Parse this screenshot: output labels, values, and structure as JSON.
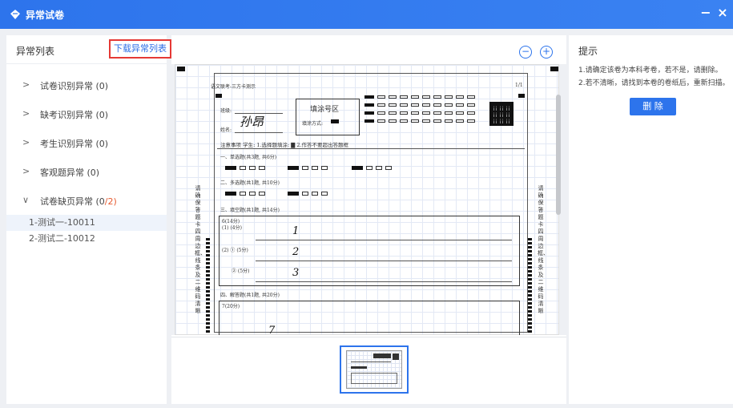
{
  "window": {
    "title": "异常试卷",
    "minimize": "−",
    "close": "×"
  },
  "left": {
    "title": "异常列表",
    "download_btn": "下载异常列表",
    "categories": [
      {
        "label": "试卷识别异常",
        "count": "(0)"
      },
      {
        "label": "缺考识别异常",
        "count": "(0)"
      },
      {
        "label": "考生识别异常",
        "count": "(0)"
      },
      {
        "label": "客观题异常",
        "count": "(0)"
      },
      {
        "label": "试卷缺页异常",
        "count_a": "(0",
        "count_b": "/2)"
      }
    ],
    "items": [
      "1-测试一-10011",
      "2-测试二-10012"
    ]
  },
  "sheet": {
    "header": "语文联考-三方卡测示",
    "page_num": "1/1",
    "class_label": "班级:",
    "name_label": "姓名:",
    "fill_area": "填涂号区",
    "fill_method": "填涂方式:",
    "notice": "注意事项  学生: 1.选择题填涂: ▇ 2.作答不要超出答题框",
    "sec1": "一、单选题(共3题, 共6分)",
    "sec2": "二、多选题(共1题, 共10分)",
    "sec3": "三、填空题(共1题, 共14分)",
    "sec3_q": "6(14分)",
    "sec3_a": "(1) (4分)",
    "sec3_b": "(2) ① (5分)",
    "sec3_c": "② (5分)",
    "sec4": "四、解答题(共1题, 共20分)",
    "sec4_q": "7(20分)",
    "side_text": "请确保答题卡四周边框、线条及二维码清晰",
    "hand_name": "孙昂",
    "hand_1": "1",
    "hand_2": "2",
    "hand_3": "3",
    "hand_7": "7"
  },
  "right": {
    "title": "提示",
    "line1": "1.请确定该卷为本科考卷，若不是，请删除。",
    "line2": "2.若不清晰，请找到本卷的卷纸后，重新扫描。",
    "delete_btn": "删 除"
  },
  "colors": {
    "accent": "#2d74ec",
    "highlight_border": "#e53935",
    "count_red": "#e65a2f"
  },
  "icons": {
    "app": "diamond-logo-icon",
    "zoom_out": "zoom-out-icon",
    "zoom_in": "zoom-in-icon",
    "chevron_right": "chevron-right-icon",
    "chevron_down": "chevron-down-icon"
  }
}
